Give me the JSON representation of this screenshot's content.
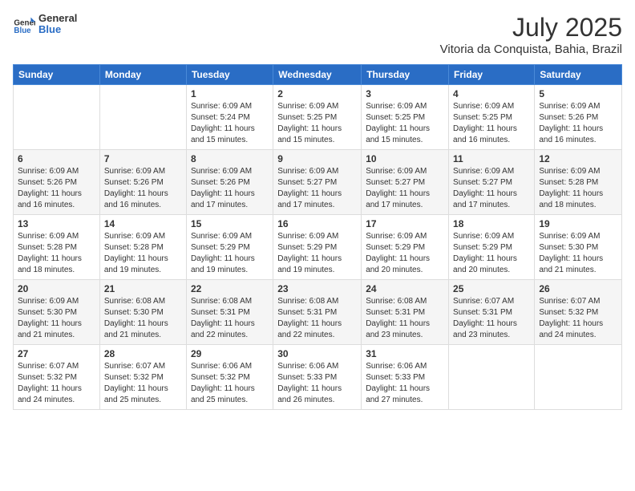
{
  "logo": {
    "line1": "General",
    "line2": "Blue"
  },
  "title": "July 2025",
  "location": "Vitoria da Conquista, Bahia, Brazil",
  "days_of_week": [
    "Sunday",
    "Monday",
    "Tuesday",
    "Wednesday",
    "Thursday",
    "Friday",
    "Saturday"
  ],
  "weeks": [
    [
      {
        "day": "",
        "content": ""
      },
      {
        "day": "",
        "content": ""
      },
      {
        "day": "1",
        "content": "Sunrise: 6:09 AM\nSunset: 5:24 PM\nDaylight: 11 hours and 15 minutes."
      },
      {
        "day": "2",
        "content": "Sunrise: 6:09 AM\nSunset: 5:25 PM\nDaylight: 11 hours and 15 minutes."
      },
      {
        "day": "3",
        "content": "Sunrise: 6:09 AM\nSunset: 5:25 PM\nDaylight: 11 hours and 15 minutes."
      },
      {
        "day": "4",
        "content": "Sunrise: 6:09 AM\nSunset: 5:25 PM\nDaylight: 11 hours and 16 minutes."
      },
      {
        "day": "5",
        "content": "Sunrise: 6:09 AM\nSunset: 5:26 PM\nDaylight: 11 hours and 16 minutes."
      }
    ],
    [
      {
        "day": "6",
        "content": "Sunrise: 6:09 AM\nSunset: 5:26 PM\nDaylight: 11 hours and 16 minutes."
      },
      {
        "day": "7",
        "content": "Sunrise: 6:09 AM\nSunset: 5:26 PM\nDaylight: 11 hours and 16 minutes."
      },
      {
        "day": "8",
        "content": "Sunrise: 6:09 AM\nSunset: 5:26 PM\nDaylight: 11 hours and 17 minutes."
      },
      {
        "day": "9",
        "content": "Sunrise: 6:09 AM\nSunset: 5:27 PM\nDaylight: 11 hours and 17 minutes."
      },
      {
        "day": "10",
        "content": "Sunrise: 6:09 AM\nSunset: 5:27 PM\nDaylight: 11 hours and 17 minutes."
      },
      {
        "day": "11",
        "content": "Sunrise: 6:09 AM\nSunset: 5:27 PM\nDaylight: 11 hours and 17 minutes."
      },
      {
        "day": "12",
        "content": "Sunrise: 6:09 AM\nSunset: 5:28 PM\nDaylight: 11 hours and 18 minutes."
      }
    ],
    [
      {
        "day": "13",
        "content": "Sunrise: 6:09 AM\nSunset: 5:28 PM\nDaylight: 11 hours and 18 minutes."
      },
      {
        "day": "14",
        "content": "Sunrise: 6:09 AM\nSunset: 5:28 PM\nDaylight: 11 hours and 19 minutes."
      },
      {
        "day": "15",
        "content": "Sunrise: 6:09 AM\nSunset: 5:29 PM\nDaylight: 11 hours and 19 minutes."
      },
      {
        "day": "16",
        "content": "Sunrise: 6:09 AM\nSunset: 5:29 PM\nDaylight: 11 hours and 19 minutes."
      },
      {
        "day": "17",
        "content": "Sunrise: 6:09 AM\nSunset: 5:29 PM\nDaylight: 11 hours and 20 minutes."
      },
      {
        "day": "18",
        "content": "Sunrise: 6:09 AM\nSunset: 5:29 PM\nDaylight: 11 hours and 20 minutes."
      },
      {
        "day": "19",
        "content": "Sunrise: 6:09 AM\nSunset: 5:30 PM\nDaylight: 11 hours and 21 minutes."
      }
    ],
    [
      {
        "day": "20",
        "content": "Sunrise: 6:09 AM\nSunset: 5:30 PM\nDaylight: 11 hours and 21 minutes."
      },
      {
        "day": "21",
        "content": "Sunrise: 6:08 AM\nSunset: 5:30 PM\nDaylight: 11 hours and 21 minutes."
      },
      {
        "day": "22",
        "content": "Sunrise: 6:08 AM\nSunset: 5:31 PM\nDaylight: 11 hours and 22 minutes."
      },
      {
        "day": "23",
        "content": "Sunrise: 6:08 AM\nSunset: 5:31 PM\nDaylight: 11 hours and 22 minutes."
      },
      {
        "day": "24",
        "content": "Sunrise: 6:08 AM\nSunset: 5:31 PM\nDaylight: 11 hours and 23 minutes."
      },
      {
        "day": "25",
        "content": "Sunrise: 6:07 AM\nSunset: 5:31 PM\nDaylight: 11 hours and 23 minutes."
      },
      {
        "day": "26",
        "content": "Sunrise: 6:07 AM\nSunset: 5:32 PM\nDaylight: 11 hours and 24 minutes."
      }
    ],
    [
      {
        "day": "27",
        "content": "Sunrise: 6:07 AM\nSunset: 5:32 PM\nDaylight: 11 hours and 24 minutes."
      },
      {
        "day": "28",
        "content": "Sunrise: 6:07 AM\nSunset: 5:32 PM\nDaylight: 11 hours and 25 minutes."
      },
      {
        "day": "29",
        "content": "Sunrise: 6:06 AM\nSunset: 5:32 PM\nDaylight: 11 hours and 25 minutes."
      },
      {
        "day": "30",
        "content": "Sunrise: 6:06 AM\nSunset: 5:33 PM\nDaylight: 11 hours and 26 minutes."
      },
      {
        "day": "31",
        "content": "Sunrise: 6:06 AM\nSunset: 5:33 PM\nDaylight: 11 hours and 27 minutes."
      },
      {
        "day": "",
        "content": ""
      },
      {
        "day": "",
        "content": ""
      }
    ]
  ]
}
